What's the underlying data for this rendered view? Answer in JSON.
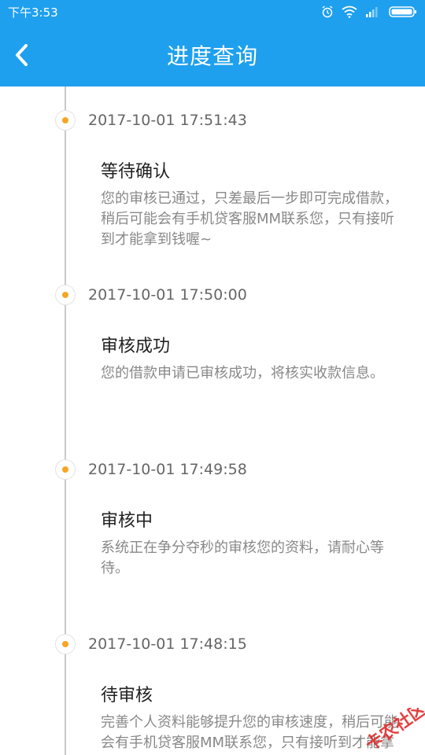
{
  "status_bar": {
    "time": "下午3:53"
  },
  "header": {
    "title": "进度查询",
    "back_icon": "chevron-left-icon"
  },
  "colors": {
    "primary": "#1ea0ee",
    "dot": "#f5a623",
    "line": "#c9c9c9"
  },
  "timeline": [
    {
      "time": "2017-10-01 17:51:43",
      "title": "等待确认",
      "desc": "您的审核已通过，只差最后一步即可完成借款，稍后可能会有手机贷客服MM联系您，只有接听到才能拿到钱喔~"
    },
    {
      "time": "2017-10-01 17:50:00",
      "title": "审核成功",
      "desc": "您的借款申请已审核成功，将核实收款信息。"
    },
    {
      "time": "2017-10-01 17:49:58",
      "title": "审核中",
      "desc": "系统正在争分夺秒的审核您的资料，请耐心等待。"
    },
    {
      "time": "2017-10-01 17:48:15",
      "title": "待审核",
      "desc": "完善个人资料能够提升您的审核速度，稍后可能会有手机贷客服MM联系您，只有接听到才能拿到钱喔~"
    }
  ],
  "watermark": {
    "text": "卡农社区"
  }
}
